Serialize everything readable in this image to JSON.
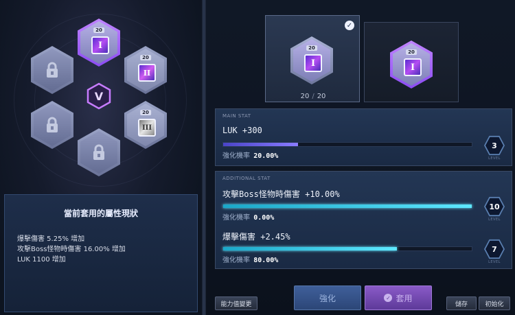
{
  "cores": {
    "level_badge": "20",
    "core_1_numeral": "I",
    "core_2_numeral": "II",
    "core_3_numeral": "III",
    "center_emblem": "V"
  },
  "summary": {
    "title": "當前套用的屬性現狀",
    "lines": [
      "爆擊傷害 5.25% 增加",
      "攻擊Boss怪物時傷害 16.00% 增加",
      "LUK 1100 增加"
    ]
  },
  "slots": {
    "slot1_level": "20",
    "slot1_numeral": "I",
    "slot2_level": "20",
    "slot2_numeral": "I",
    "count_current": "20",
    "count_separator": "/",
    "count_max": "20"
  },
  "main_stat": {
    "header": "MAIN STAT",
    "name": "LUK +300",
    "prob_label": "強化機率",
    "prob_value": "20.00%",
    "progress": 0.3,
    "level": "3",
    "level_label": "LEVEL"
  },
  "additional_stat": {
    "header": "ADDITIONAL STAT",
    "stats": [
      {
        "name": "攻擊Boss怪物時傷害 +10.00%",
        "prob_label": "強化機率",
        "prob_value": "0.00%",
        "progress": 1.0,
        "level": "10",
        "level_label": "LEVEL"
      },
      {
        "name": "爆擊傷害 +2.45%",
        "prob_label": "強化機率",
        "prob_value": "80.00%",
        "progress": 0.7,
        "level": "7",
        "level_label": "LEVEL"
      }
    ]
  },
  "buttons": {
    "change_ability": "能力值變更",
    "enhance": "強化",
    "apply": "套用",
    "save": "儲存",
    "reset": "初始化"
  },
  "colors": {
    "accent_purple": "#a46cff",
    "accent_cyan": "#5ee8ff",
    "panel_bg": "#1a2a44"
  }
}
